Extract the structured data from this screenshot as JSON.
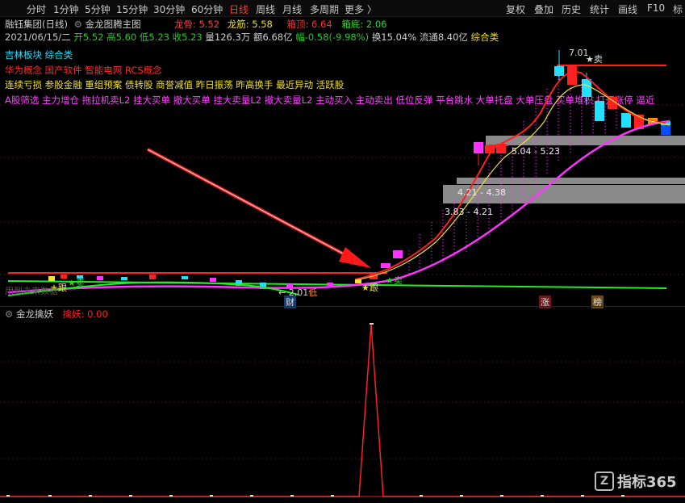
{
  "toolbar": {
    "items": [
      "分时",
      "1分钟",
      "5分钟",
      "15分钟",
      "30分钟",
      "60分钟",
      "日线",
      "周线",
      "月线",
      "多周期",
      "更多 〉"
    ],
    "active": "日线",
    "right": [
      "复权",
      "叠加",
      "历史",
      "统计",
      "画线",
      "F10",
      "标"
    ]
  },
  "header": {
    "stock": "融钰集团(日线)",
    "indicator": "金龙图腾主图",
    "long_gu_label": "龙骨:",
    "long_gu": "5.52",
    "long_jin_label": "龙筋:",
    "long_jin": "5.58",
    "xiang_ding_label": "箱顶:",
    "xiang_ding": "6.64",
    "xiang_di_label": "箱底:",
    "xiang_di": "2.06"
  },
  "quote": {
    "date": "2021/06/15/二",
    "open": "开5.52",
    "high": "高5.60",
    "low": "低5.23",
    "close": "收5.23",
    "volume": "量126.3万",
    "amount": "额6.68亿",
    "change": "幅-0.58(-9.98%)",
    "turnover": "换15.04%",
    "float_cap": "流通8.40亿",
    "category": "综合类"
  },
  "concepts": {
    "line1": "吉林板块  综合类",
    "line2": "华为概念  国产软件  智能电网  RCS概念",
    "line3": "连续亏损  参股金融  重组预案  债转股  商誉减值  昨日振荡  昨高换手  最近异动  活跃股",
    "line4": "A股筛选  主力增仓  拖拉机卖L2  挂大买单  撤大买单  挂大卖量L2  撤大卖量L2  主动买入  主动卖出  低位反弹  平台跳水  大单托盘  大单压盘  买单堆积  打开涨停  逼近"
  },
  "annotations": {
    "high_price": "7.01",
    "sell_top": "★卖",
    "zone1": "5.04 - 5.23",
    "zone2": "4.21 - 4.38",
    "zone3": "3.83 - 4.21",
    "low_price": "2.01",
    "low_tag": "低",
    "follow1": "★跟",
    "follow2": "★跟",
    "sell_mid": "★卖",
    "sell_left": "★卖",
    "watermark_left": "用到未来数据",
    "badge_cai": "财",
    "badge_zhang": "涨",
    "badge_bang": "榜"
  },
  "sub_panel": {
    "title": "金龙擒妖",
    "label": "擒妖:",
    "value": "0.00"
  },
  "logo": "指标365",
  "colors": {
    "up": "#ff2020",
    "down": "#00e0ff",
    "magenta": "#ff33ff",
    "yellow": "#f0e030",
    "green": "#22dd22",
    "gray_zone": "#8a8a8a"
  },
  "chart_data": {
    "type": "line",
    "series": [
      {
        "name": "擒妖",
        "x_note": "spike near bar of rally start",
        "values": [
          0,
          0,
          0,
          0,
          0,
          0,
          0,
          0,
          0,
          0,
          0,
          0,
          0,
          1,
          0,
          0,
          0,
          0,
          0,
          0
        ]
      }
    ]
  }
}
